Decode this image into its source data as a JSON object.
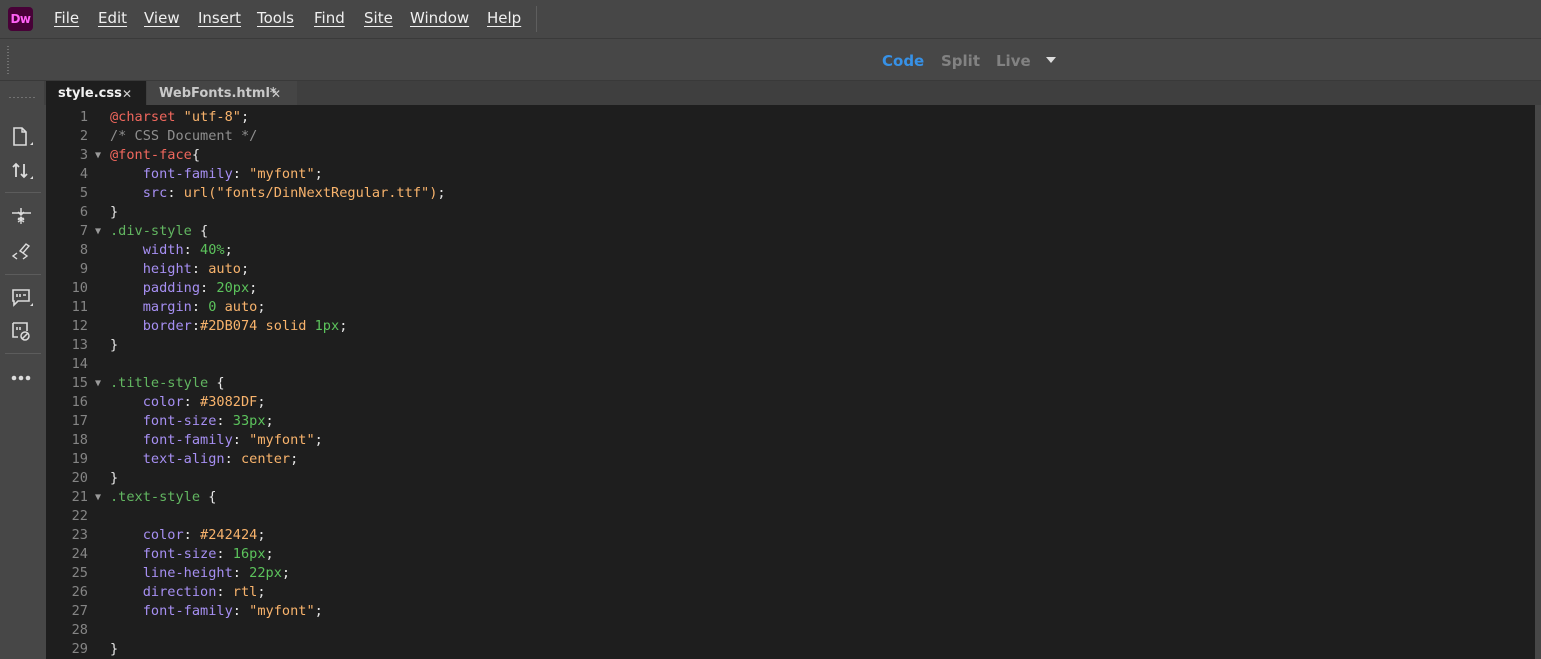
{
  "app": {
    "logo_text": "Dw",
    "logo_bg": "#470137",
    "logo_fg": "#FF61F6"
  },
  "menu": [
    "File",
    "Edit",
    "View",
    "Insert",
    "Tools",
    "Find",
    "Site",
    "Window",
    "Help"
  ],
  "view_switcher": {
    "code": "Code",
    "split": "Split",
    "live": "Live",
    "active": "Code",
    "active_color": "#3791E6"
  },
  "tabs": [
    {
      "label": "style.css",
      "active": true
    },
    {
      "label": "WebFonts.html*",
      "active": false
    }
  ],
  "toolbar_icons": [
    "file-management-icon",
    "get-put-icon",
    "expand-collapse-icon",
    "apply-comment-icon",
    "format-source-icon",
    "comment-icon",
    "remove-comment-icon",
    "more-icon"
  ],
  "editor": {
    "lines": [
      {
        "n": "1",
        "fold": "",
        "tokens": [
          [
            "at",
            "@charset"
          ],
          [
            "pun",
            " "
          ],
          [
            "str",
            "\"utf-8\""
          ],
          [
            "pun",
            ";"
          ]
        ]
      },
      {
        "n": "2",
        "fold": "",
        "tokens": [
          [
            "com",
            "/* CSS Document */"
          ]
        ]
      },
      {
        "n": "3",
        "fold": "▼",
        "tokens": [
          [
            "at",
            "@font-face"
          ],
          [
            "pun",
            "{"
          ]
        ]
      },
      {
        "n": "4",
        "fold": "",
        "tokens": [
          [
            "pun",
            "    "
          ],
          [
            "prop",
            "font-family"
          ],
          [
            "pun",
            ": "
          ],
          [
            "str",
            "\"myfont\""
          ],
          [
            "pun",
            ";"
          ]
        ]
      },
      {
        "n": "5",
        "fold": "",
        "tokens": [
          [
            "pun",
            "    "
          ],
          [
            "prop",
            "src"
          ],
          [
            "pun",
            ": "
          ],
          [
            "val",
            "url("
          ],
          [
            "str",
            "\"fonts/DinNextRegular.ttf\""
          ],
          [
            "val",
            ")"
          ],
          [
            "pun",
            ";"
          ]
        ]
      },
      {
        "n": "6",
        "fold": "",
        "tokens": [
          [
            "pun",
            "}"
          ]
        ]
      },
      {
        "n": "7",
        "fold": "▼",
        "tokens": [
          [
            "sel",
            ".div-style"
          ],
          [
            "pun",
            " {"
          ]
        ]
      },
      {
        "n": "8",
        "fold": "",
        "tokens": [
          [
            "pun",
            "    "
          ],
          [
            "prop",
            "width"
          ],
          [
            "pun",
            ": "
          ],
          [
            "num",
            "40%"
          ],
          [
            "pun",
            ";"
          ]
        ]
      },
      {
        "n": "9",
        "fold": "",
        "tokens": [
          [
            "pun",
            "    "
          ],
          [
            "prop",
            "height"
          ],
          [
            "pun",
            ": "
          ],
          [
            "val",
            "auto"
          ],
          [
            "pun",
            ";"
          ]
        ]
      },
      {
        "n": "10",
        "fold": "",
        "tokens": [
          [
            "pun",
            "    "
          ],
          [
            "prop",
            "padding"
          ],
          [
            "pun",
            ": "
          ],
          [
            "num",
            "20px"
          ],
          [
            "pun",
            ";"
          ]
        ]
      },
      {
        "n": "11",
        "fold": "",
        "tokens": [
          [
            "pun",
            "    "
          ],
          [
            "prop",
            "margin"
          ],
          [
            "pun",
            ": "
          ],
          [
            "num",
            "0"
          ],
          [
            "pun",
            " "
          ],
          [
            "val",
            "auto"
          ],
          [
            "pun",
            ";"
          ]
        ]
      },
      {
        "n": "12",
        "fold": "",
        "tokens": [
          [
            "pun",
            "    "
          ],
          [
            "prop",
            "border"
          ],
          [
            "pun",
            ":"
          ],
          [
            "val",
            "#2DB074 solid "
          ],
          [
            "num",
            "1px"
          ],
          [
            "pun",
            ";"
          ]
        ]
      },
      {
        "n": "13",
        "fold": "",
        "tokens": [
          [
            "pun",
            "}"
          ]
        ]
      },
      {
        "n": "14",
        "fold": "",
        "tokens": []
      },
      {
        "n": "15",
        "fold": "▼",
        "tokens": [
          [
            "sel",
            ".title-style"
          ],
          [
            "pun",
            " {"
          ]
        ]
      },
      {
        "n": "16",
        "fold": "",
        "tokens": [
          [
            "pun",
            "    "
          ],
          [
            "prop",
            "color"
          ],
          [
            "pun",
            ": "
          ],
          [
            "val",
            "#3082DF"
          ],
          [
            "pun",
            ";"
          ]
        ]
      },
      {
        "n": "17",
        "fold": "",
        "tokens": [
          [
            "pun",
            "    "
          ],
          [
            "prop",
            "font-size"
          ],
          [
            "pun",
            ": "
          ],
          [
            "num",
            "33px"
          ],
          [
            "pun",
            ";"
          ]
        ]
      },
      {
        "n": "18",
        "fold": "",
        "tokens": [
          [
            "pun",
            "    "
          ],
          [
            "prop",
            "font-family"
          ],
          [
            "pun",
            ": "
          ],
          [
            "str",
            "\"myfont\""
          ],
          [
            "pun",
            ";"
          ]
        ]
      },
      {
        "n": "19",
        "fold": "",
        "tokens": [
          [
            "pun",
            "    "
          ],
          [
            "prop",
            "text-align"
          ],
          [
            "pun",
            ": "
          ],
          [
            "val",
            "center"
          ],
          [
            "pun",
            ";"
          ]
        ]
      },
      {
        "n": "20",
        "fold": "",
        "tokens": [
          [
            "pun",
            "}"
          ]
        ]
      },
      {
        "n": "21",
        "fold": "▼",
        "tokens": [
          [
            "sel",
            ".text-style"
          ],
          [
            "pun",
            " {"
          ]
        ]
      },
      {
        "n": "22",
        "fold": "",
        "tokens": []
      },
      {
        "n": "23",
        "fold": "",
        "tokens": [
          [
            "pun",
            "    "
          ],
          [
            "prop",
            "color"
          ],
          [
            "pun",
            ": "
          ],
          [
            "val",
            "#242424"
          ],
          [
            "pun",
            ";"
          ]
        ]
      },
      {
        "n": "24",
        "fold": "",
        "tokens": [
          [
            "pun",
            "    "
          ],
          [
            "prop",
            "font-size"
          ],
          [
            "pun",
            ": "
          ],
          [
            "num",
            "16px"
          ],
          [
            "pun",
            ";"
          ]
        ]
      },
      {
        "n": "25",
        "fold": "",
        "tokens": [
          [
            "pun",
            "    "
          ],
          [
            "prop",
            "line-height"
          ],
          [
            "pun",
            ": "
          ],
          [
            "num",
            "22px"
          ],
          [
            "pun",
            ";"
          ]
        ]
      },
      {
        "n": "26",
        "fold": "",
        "tokens": [
          [
            "pun",
            "    "
          ],
          [
            "prop",
            "direction"
          ],
          [
            "pun",
            ": "
          ],
          [
            "val",
            "rtl"
          ],
          [
            "pun",
            ";"
          ]
        ]
      },
      {
        "n": "27",
        "fold": "",
        "tokens": [
          [
            "pun",
            "    "
          ],
          [
            "prop",
            "font-family"
          ],
          [
            "pun",
            ": "
          ],
          [
            "str",
            "\"myfont\""
          ],
          [
            "pun",
            ";"
          ]
        ]
      },
      {
        "n": "28",
        "fold": "",
        "tokens": []
      },
      {
        "n": "29",
        "fold": "",
        "tokens": [
          [
            "pun",
            "}"
          ]
        ]
      }
    ]
  }
}
